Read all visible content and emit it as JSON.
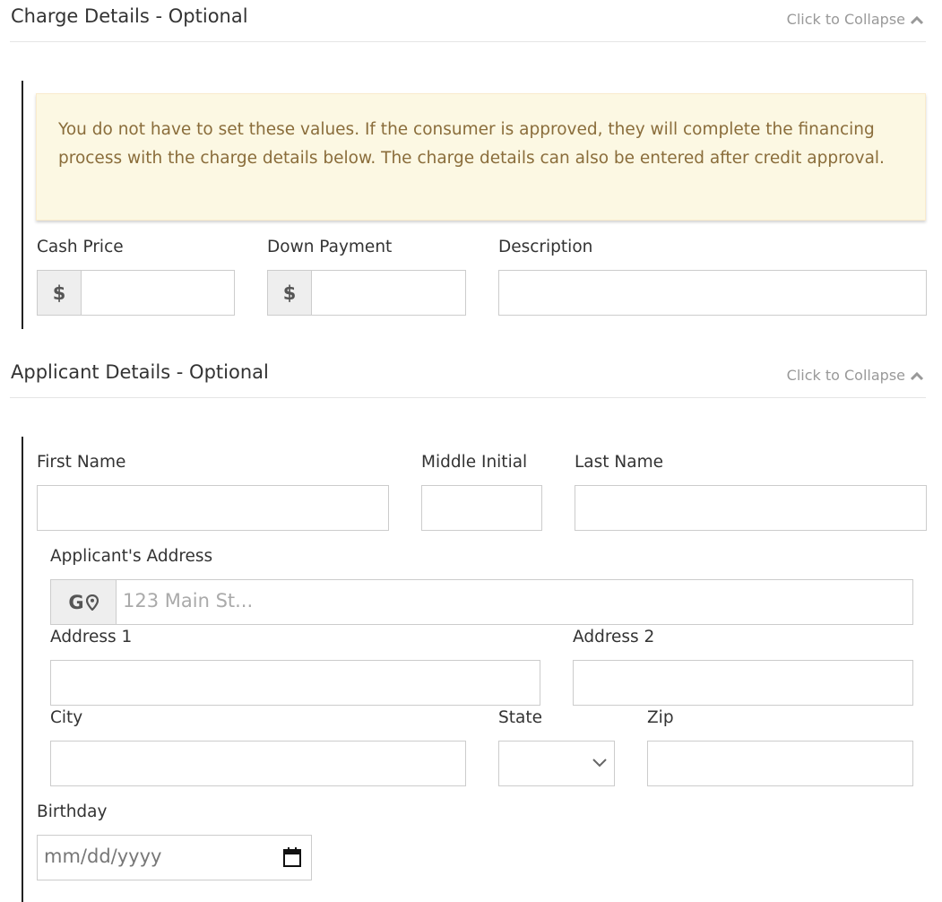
{
  "charge_section": {
    "title": "Charge Details - Optional",
    "collapse_label": "Click to Collapse",
    "alert_text": "You do not have to set these values. If the consumer is approved, they will complete the financing process with the charge details below. The charge details can also be entered after credit approval.",
    "cash_price_label": "Cash Price",
    "down_payment_label": "Down Payment",
    "description_label": "Description",
    "currency_symbol": "$"
  },
  "applicant_section": {
    "title": "Applicant Details - Optional",
    "collapse_label": "Click to Collapse",
    "first_name_label": "First Name",
    "middle_initial_label": "Middle Initial",
    "last_name_label": "Last Name",
    "address_label": "Applicant's Address",
    "address_addon": "G",
    "address_placeholder": "123 Main St...",
    "address1_label": "Address 1",
    "address2_label": "Address 2",
    "city_label": "City",
    "state_label": "State",
    "zip_label": "Zip",
    "birthday_label": "Birthday",
    "birthday_placeholder": "mm/dd/yyyy"
  },
  "icons": {
    "collapse": "chevron-up-icon",
    "address_addon": "map-pin-icon",
    "state": "chevron-down-icon",
    "birthday": "calendar-icon"
  }
}
